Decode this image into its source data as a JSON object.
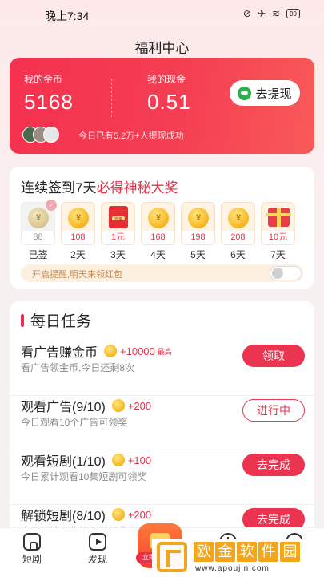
{
  "status_bar": {
    "time": "晚上7:34",
    "battery": "99"
  },
  "page_title": "福利中心",
  "coin_card": {
    "coins_label": "我的金币",
    "coins_value": "5168",
    "cash_label": "我的现金",
    "cash_value": "0.51",
    "withdraw_label": "去提现",
    "success_note": "今日已有5.2万+人提现成功"
  },
  "signin": {
    "title_prefix": "连续签到7天",
    "title_highlight": "必得神秘大奖",
    "days": [
      {
        "amount": "88",
        "label": "已签",
        "icon": "coin-icon",
        "done": true
      },
      {
        "amount": "108",
        "label": "2天",
        "icon": "coin-icon",
        "done": false
      },
      {
        "amount": "1元",
        "label": "3天",
        "icon": "red-envelope-icon",
        "done": false
      },
      {
        "amount": "168",
        "label": "4天",
        "icon": "coin-icon",
        "done": false
      },
      {
        "amount": "198",
        "label": "5天",
        "icon": "coin-icon",
        "done": false
      },
      {
        "amount": "208",
        "label": "6天",
        "icon": "coin-icon",
        "done": false
      },
      {
        "amount": "10元",
        "label": "7天",
        "icon": "gift-box-icon",
        "done": false
      }
    ],
    "coin_symbol": "¥",
    "envelope_text": "现金",
    "reminder_text": "开启提醒,明天来领红包",
    "reminder_on": false
  },
  "tasks": {
    "header": "每日任务",
    "items": [
      {
        "title": "看广告赚金币",
        "reward": "+10000",
        "max": "最高",
        "sub": "看广告领金币,今日还剩8次",
        "button": "领取",
        "style": "solid"
      },
      {
        "title": "观看广告(9/10)",
        "reward": "+200",
        "max": "",
        "sub": "今日观看10个广告可领奖",
        "button": "进行中",
        "style": "outline"
      },
      {
        "title": "观看短剧(1/10)",
        "reward": "+100",
        "max": "",
        "sub": "今日累计观看10集短剧可领奖",
        "button": "去完成",
        "style": "solid"
      },
      {
        "title": "解锁短剧(8/10)",
        "reward": "+200",
        "max": "",
        "sub": "今日解锁10集短剧可领奖",
        "button": "去完成",
        "style": "solid"
      }
    ]
  },
  "bottom_nav": {
    "items": [
      {
        "label": "短剧",
        "icon": "home-icon"
      },
      {
        "label": "发现",
        "icon": "play-icon"
      },
      {
        "label": "立即领",
        "icon": "gift-icon"
      },
      {
        "label": "",
        "icon": "clock-icon"
      },
      {
        "label": "",
        "icon": "profile-icon"
      }
    ]
  },
  "watermark": {
    "chars": [
      "欧",
      "金",
      "软",
      "件",
      "园"
    ],
    "url": "www.apoujin.com"
  },
  "colors": {
    "accent": "#e8304a",
    "card_gradient_start": "#f5314f",
    "card_gradient_end": "#f95a59",
    "coin_gold": "#f7b51e"
  }
}
